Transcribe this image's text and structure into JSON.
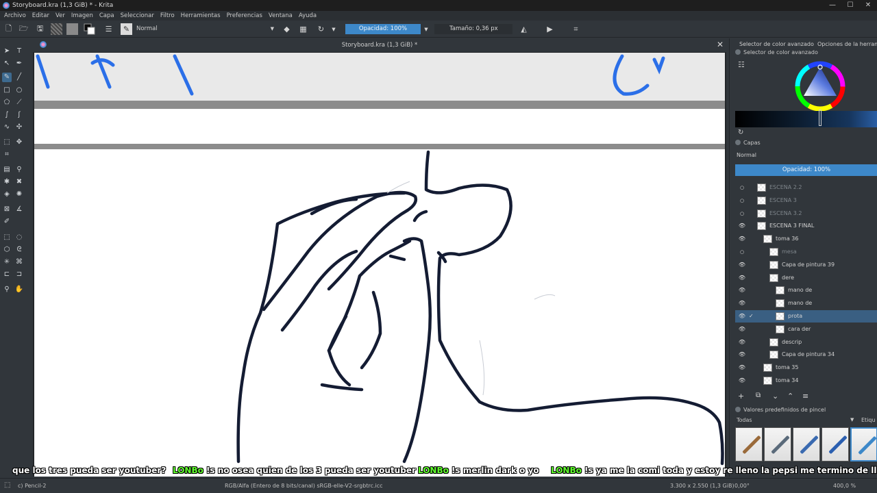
{
  "window": {
    "title": "Storyboard.kra (1,3 GiB) * - Krita",
    "controls": [
      "—",
      "☐",
      "✕"
    ]
  },
  "menu": [
    "Archivo",
    "Editar",
    "Ver",
    "Imagen",
    "Capa",
    "Seleccionar",
    "Filtro",
    "Herramientas",
    "Preferencias",
    "Ventana",
    "Ayuda"
  ],
  "toolbar": {
    "blend_mode": "Normal",
    "opacity_label": "Opacidad: 100%",
    "size_label": "Tamaño: 0,36 px"
  },
  "document": {
    "tab_title": "Storyboard.kra (1,3 GiB) *",
    "close": "✕"
  },
  "docker": {
    "tabs": [
      "Selector de color avanzado",
      "Opciones de la herramienta"
    ],
    "color_selector_title": "Selector de color avanzado",
    "layers_title": "Capas",
    "layers_blend": "Normal",
    "layers_opacity": "Opacidad:  100%",
    "layers": [
      {
        "name": "ESCENA 2.2",
        "visible": false,
        "indent": 0,
        "group": true
      },
      {
        "name": "ESCENA 3",
        "visible": false,
        "indent": 0,
        "group": true
      },
      {
        "name": "ESCENA 3.2",
        "visible": false,
        "indent": 0,
        "group": true
      },
      {
        "name": "ESCENA 3 FINAL",
        "visible": true,
        "indent": 0,
        "group": true
      },
      {
        "name": "toma 36",
        "visible": true,
        "indent": 1,
        "group": true
      },
      {
        "name": "mesa",
        "visible": false,
        "indent": 2,
        "group": false
      },
      {
        "name": "Capa de pintura 39",
        "visible": true,
        "indent": 2,
        "group": false
      },
      {
        "name": "dere",
        "visible": true,
        "indent": 2,
        "group": true
      },
      {
        "name": "mano de",
        "visible": true,
        "indent": 3,
        "group": false
      },
      {
        "name": "mano de",
        "visible": true,
        "indent": 3,
        "group": false
      },
      {
        "name": "prota",
        "visible": true,
        "indent": 3,
        "group": false,
        "selected": true
      },
      {
        "name": "cara der",
        "visible": true,
        "indent": 3,
        "group": false
      },
      {
        "name": "descrip",
        "visible": true,
        "indent": 2,
        "group": false
      },
      {
        "name": "Capa de pintura 34",
        "visible": true,
        "indent": 2,
        "group": false
      },
      {
        "name": "toma 35",
        "visible": true,
        "indent": 1,
        "group": true
      },
      {
        "name": "toma 34",
        "visible": true,
        "indent": 1,
        "group": true
      }
    ],
    "layer_buttons": [
      "+",
      "⧉",
      "⌄",
      "⌃",
      "≡"
    ],
    "brush_presets_title": "Valores predefinidos de pincel",
    "brush_filter": "Todas",
    "brush_tag": "Etiqu"
  },
  "chat": [
    {
      "nick": "",
      "text": "que los tres pueda ser youtuber?"
    },
    {
      "nick": "LONBo",
      "text": "!s no osea quien de los 3 pueda ser youtuber"
    },
    {
      "nick": "LONBo",
      "text": "!s merlin dark o yo"
    },
    {
      "nick": "LONBo",
      "text": "!s ya me la comi toda y estoy re lleno la pepsi me termino de llana"
    }
  ],
  "status": {
    "tool": "c) Pencil-2",
    "color_space": "RGB/Alfa (Entero de 8 bits/canal)  sRGB-elle-V2-srgbtrc.icc",
    "dimensions": "3.300 x 2.550 (1,3 GiB)",
    "rotation": "0,00°",
    "zoom": "400,0 %"
  },
  "colors": {
    "accent": "#3d88c9",
    "selected_layer": "#3a5f82",
    "chat_nick": "#61ff2e",
    "stroke": "#141c33",
    "blue_ink": "#2b6fe8"
  }
}
